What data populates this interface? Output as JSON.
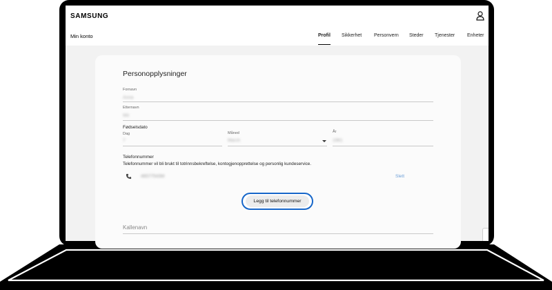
{
  "header": {
    "brand": "SAMSUNG",
    "account_title": "Min konto",
    "user_icon": "user-icon"
  },
  "nav": {
    "tabs": [
      {
        "label": "Profil",
        "active": true
      },
      {
        "label": "Sikkerhet",
        "active": false
      },
      {
        "label": "Personvern",
        "active": false
      },
      {
        "label": "Steder",
        "active": false
      },
      {
        "label": "Tjenester",
        "active": false
      },
      {
        "label": "Enheter",
        "active": false
      }
    ]
  },
  "form": {
    "section_title": "Personopplysninger",
    "first_name": {
      "label": "Fornavn",
      "value": "Anna"
    },
    "last_name": {
      "label": "Etternavn",
      "value": "Wii"
    },
    "birthdate": {
      "title": "Fødselsdato",
      "day": {
        "label": "Dag",
        "value": "7"
      },
      "month": {
        "label": "Måned",
        "value": "March"
      },
      "year": {
        "label": "År",
        "value": "1981"
      }
    },
    "phone": {
      "title": "Telefonnummer",
      "description": "Telefonnummer vil bli brukt til totrinnsbekreftelse, kontogjenopprettelse og personlig kundeservice.",
      "number": "46577543M",
      "delete_label": "Slett",
      "icon": "phone-icon"
    },
    "add_phone_button": "Legg til telefonnummer",
    "nickname": {
      "label": "Kallenavn"
    }
  },
  "colors": {
    "highlight_ring": "#1666c9",
    "link": "#6ea0d8",
    "page_bg": "#f2f2f2",
    "card_bg": "#fbfbfb"
  }
}
